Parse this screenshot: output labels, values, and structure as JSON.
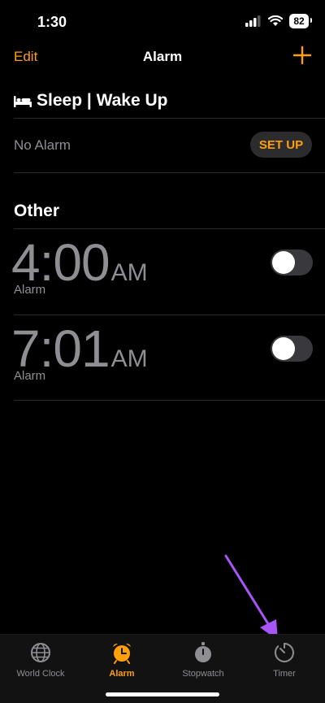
{
  "status": {
    "time": "1:30",
    "battery": "82"
  },
  "nav": {
    "edit_label": "Edit",
    "title": "Alarm"
  },
  "sleep": {
    "title": "Sleep | Wake Up",
    "no_alarm": "No Alarm",
    "setup_label": "SET UP"
  },
  "other": {
    "title": "Other"
  },
  "alarms": [
    {
      "time": "4:00",
      "ampm": "AM",
      "label": "Alarm",
      "enabled": false
    },
    {
      "time": "7:01",
      "ampm": "AM",
      "label": "Alarm",
      "enabled": false
    }
  ],
  "tabs": [
    {
      "label": "World Clock",
      "icon": "globe-icon",
      "active": false
    },
    {
      "label": "Alarm",
      "icon": "alarm-clock-icon",
      "active": true
    },
    {
      "label": "Stopwatch",
      "icon": "stopwatch-icon",
      "active": false
    },
    {
      "label": "Timer",
      "icon": "timer-icon",
      "active": false
    }
  ],
  "colors": {
    "accent": "#ff9f0a",
    "inactive": "#8e8e93",
    "annotation": "#a855f7"
  }
}
